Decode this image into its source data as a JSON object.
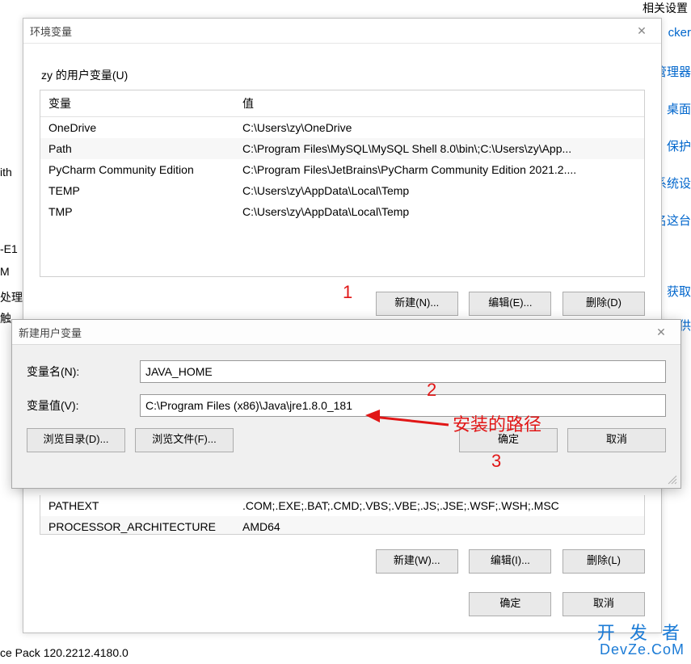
{
  "bg": {
    "left": {
      "l1": "ith",
      "l2": "-E1",
      "l3": "M",
      "l4": "处理",
      "l5": "触",
      "l6": "ce Pack 120.2212.4180.0"
    },
    "rightTop": "相关设置",
    "links": {
      "a": "cker",
      "b": "管理器",
      "c": "桌面",
      "d": "保护",
      "e": "系统设",
      "f": "名这台",
      "g": "获取",
      "h": "提供"
    }
  },
  "mainDialog": {
    "title": "环境变量",
    "userSectionLabel": "zy 的用户变量(U)",
    "cols": {
      "name": "变量",
      "value": "值"
    },
    "userVars": [
      {
        "name": "OneDrive",
        "value": "C:\\Users\\zy\\OneDrive"
      },
      {
        "name": "Path",
        "value": "C:\\Program Files\\MySQL\\MySQL Shell 8.0\\bin\\;C:\\Users\\zy\\App..."
      },
      {
        "name": "PyCharm Community Edition",
        "value": "C:\\Program Files\\JetBrains\\PyCharm Community Edition 2021.2...."
      },
      {
        "name": "TEMP",
        "value": "C:\\Users\\zy\\AppData\\Local\\Temp"
      },
      {
        "name": "TMP",
        "value": "C:\\Users\\zy\\AppData\\Local\\Temp"
      }
    ],
    "userButtons": {
      "new": "新建(N)...",
      "edit": "编辑(E)...",
      "del": "删除(D)"
    },
    "sysVars": [
      {
        "name": "PATHEXT",
        "value": ".COM;.EXE;.BAT;.CMD;.VBS;.VBE;.JS;.JSE;.WSF;.WSH;.MSC"
      },
      {
        "name": "PROCESSOR_ARCHITECTURE",
        "value": "AMD64"
      }
    ],
    "sysButtons": {
      "new": "新建(W)...",
      "edit": "编辑(I)...",
      "del": "删除(L)"
    },
    "footer": {
      "ok": "确定",
      "cancel": "取消"
    }
  },
  "newVarDialog": {
    "title": "新建用户变量",
    "nameLabel": "变量名(N):",
    "nameValue": "JAVA_HOME",
    "valueLabel": "变量值(V):",
    "valueValue": "C:\\Program Files (x86)\\Java\\jre1.8.0_181",
    "browseDir": "浏览目录(D)...",
    "browseFile": "浏览文件(F)...",
    "ok": "确定",
    "cancel": "取消"
  },
  "annotations": {
    "n1": "1",
    "n2": "2",
    "n3": "3",
    "pathNote": "安装的路径"
  },
  "watermark": {
    "l1": "开 发 者",
    "l2": "DevZe.CoM"
  }
}
